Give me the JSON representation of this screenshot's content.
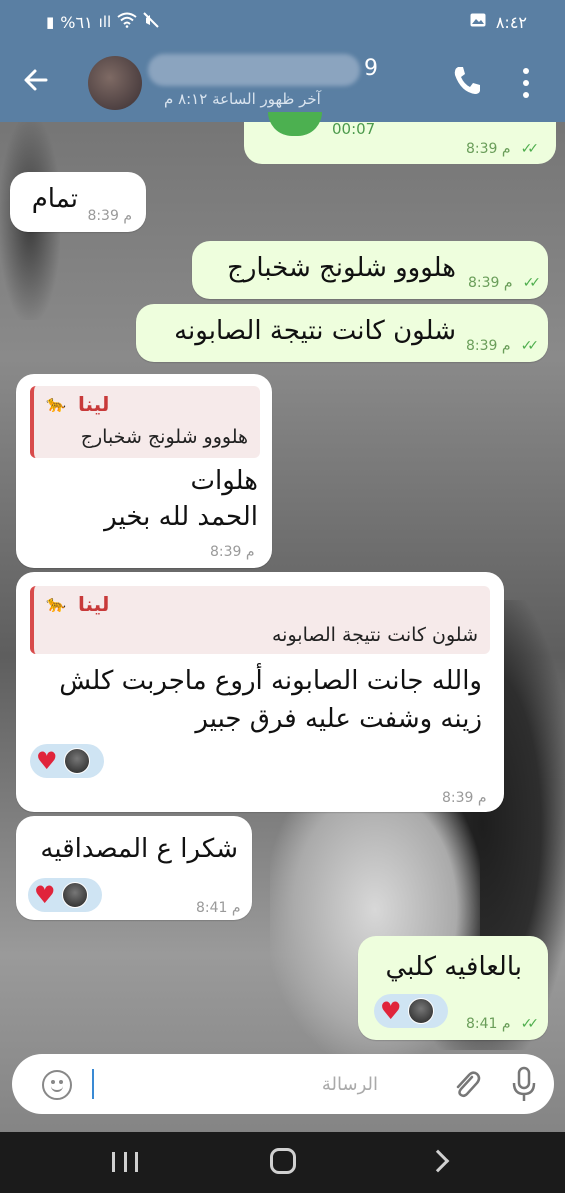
{
  "status_bar": {
    "time": "٨:٤٢",
    "battery": "%٦١",
    "icons": [
      "image-icon",
      "mute-icon",
      "wifi-icon",
      "signal-icon",
      "battery-icon"
    ]
  },
  "header": {
    "contact_digit": "9",
    "last_seen": "آخر ظهور الساعة ٨:١٢ م",
    "icons": [
      "back-arrow-icon",
      "avatar",
      "phone-icon",
      "more-vert-icon"
    ]
  },
  "audio_message": {
    "duration": "00:07",
    "time": "8:39 م"
  },
  "messages": [
    {
      "dir": "in",
      "text": "تمام",
      "time": "8:39 م"
    },
    {
      "dir": "out",
      "text": "هلووو شلونج شخبارج",
      "time": "8:39 م"
    },
    {
      "dir": "out",
      "text": "شلون كانت نتيجة الصابونه",
      "time": "8:39 م"
    },
    {
      "dir": "in",
      "reply_name": "لينا",
      "reply_text": "هلووو شلونج شخبارج",
      "line1": "هلوات",
      "line2": "الحمد لله بخير",
      "time": "8:39 م"
    },
    {
      "dir": "in",
      "reply_name": "لينا",
      "reply_text": "شلون كانت نتيجة الصابونه",
      "line1": "والله جانت الصابونه أروع ماجربت كلش",
      "line2": "زينه وشفت عليه فرق جبير",
      "time": "8:39 م"
    },
    {
      "dir": "in",
      "text": "شكرا ع المصداقيه",
      "time": "8:41 م"
    },
    {
      "dir": "out",
      "text": "بالعافيه كلبي",
      "time": "8:41 م"
    }
  ],
  "input": {
    "placeholder": "الرسالة"
  },
  "colors": {
    "header": "#5a7fa3",
    "outgoing_bubble": "#eefedd",
    "incoming_bubble": "#ffffff",
    "reply_accent": "#d84b4b",
    "heart": "#e0243b"
  }
}
